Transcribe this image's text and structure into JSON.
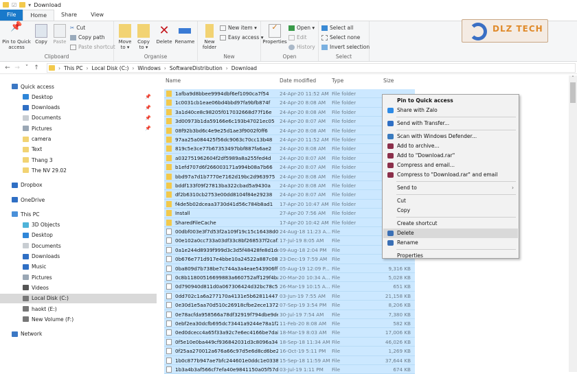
{
  "window": {
    "title": "Download"
  },
  "tabs": [
    {
      "label": "File"
    },
    {
      "label": "Home"
    },
    {
      "label": "Share"
    },
    {
      "label": "View"
    }
  ],
  "ribbon": {
    "clipboard": {
      "label": "Clipboard",
      "pin": "Pin to Quick access",
      "copy": "Copy",
      "paste": "Paste",
      "cut": "Cut",
      "copy_path": "Copy path",
      "paste_shortcut": "Paste shortcut"
    },
    "organise": {
      "label": "Organise",
      "move_to": "Move to ▾",
      "copy_to": "Copy to ▾",
      "delete": "Delete",
      "rename": "Rename"
    },
    "new": {
      "label": "New",
      "new_folder": "New folder",
      "new_item": "New item ▾",
      "easy_access": "Easy access ▾"
    },
    "open": {
      "label": "Open",
      "properties": "Properties",
      "open": "Open ▾",
      "edit": "Edit",
      "history": "History"
    },
    "select": {
      "label": "Select",
      "select_all": "Select all",
      "select_none": "Select none",
      "invert": "Invert selection"
    }
  },
  "logo": {
    "text": "DLZ TECH"
  },
  "address": {
    "crumbs": [
      "This PC",
      "Local Disk (C:)",
      "Windows",
      "SoftwareDistribution",
      "Download"
    ]
  },
  "sidebar": [
    {
      "label": "Quick access",
      "level": 0,
      "icon": "star",
      "color": "#3b78c4"
    },
    {
      "label": "Desktop",
      "level": 1,
      "icon": "desktop",
      "color": "#2f86d8",
      "pinned": true
    },
    {
      "label": "Downloads",
      "level": 1,
      "icon": "download",
      "color": "#2f6fc4",
      "pinned": true
    },
    {
      "label": "Documents",
      "level": 1,
      "icon": "document",
      "color": "#c8cdd2",
      "pinned": true
    },
    {
      "label": "Pictures",
      "level": 1,
      "icon": "pictures",
      "color": "#9aa7b5",
      "pinned": true
    },
    {
      "label": "camera",
      "level": 1,
      "icon": "folder",
      "color": "#f2d373"
    },
    {
      "label": "Text",
      "level": 1,
      "icon": "folder",
      "color": "#f2d373"
    },
    {
      "label": "Thang 3",
      "level": 1,
      "icon": "folder",
      "color": "#f2d373"
    },
    {
      "label": "The NV 29.02",
      "level": 1,
      "icon": "folder",
      "color": "#f2d373"
    },
    {
      "label": "Dropbox",
      "level": 0,
      "icon": "dropbox",
      "color": "#2f6fc4",
      "gap": true
    },
    {
      "label": "OneDrive",
      "level": 0,
      "icon": "cloud",
      "color": "#2f6fc4",
      "gap": true
    },
    {
      "label": "This PC",
      "level": 0,
      "icon": "computer",
      "color": "#4a90d9",
      "gap": true
    },
    {
      "label": "3D Objects",
      "level": 1,
      "icon": "cube",
      "color": "#4fb3d9"
    },
    {
      "label": "Desktop",
      "level": 1,
      "icon": "desktop",
      "color": "#2f86d8"
    },
    {
      "label": "Documents",
      "level": 1,
      "icon": "document",
      "color": "#c8cdd2"
    },
    {
      "label": "Downloads",
      "level": 1,
      "icon": "download",
      "color": "#2f6fc4"
    },
    {
      "label": "Music",
      "level": 1,
      "icon": "music",
      "color": "#2f6fc4"
    },
    {
      "label": "Pictures",
      "level": 1,
      "icon": "pictures",
      "color": "#9aa7b5"
    },
    {
      "label": "Videos",
      "level": 1,
      "icon": "video",
      "color": "#555"
    },
    {
      "label": "Local Disk (C:)",
      "level": 1,
      "icon": "drive",
      "color": "#777",
      "selected": true
    },
    {
      "label": "haokt (E:)",
      "level": 1,
      "icon": "drive",
      "color": "#777"
    },
    {
      "label": "New Volume (F:)",
      "level": 1,
      "icon": "drive",
      "color": "#777"
    },
    {
      "label": "Network",
      "level": 0,
      "icon": "network",
      "color": "#3b78c4",
      "gap": true
    }
  ],
  "columns": {
    "name": "Name",
    "date": "Date modified",
    "type": "Type",
    "size": "Size"
  },
  "files": [
    {
      "name": "1afba9d8bbee9994dbf6ef1090ca7f54",
      "date": "24-Apr-20 11:52 AM",
      "type": "File folder",
      "size": "",
      "folder": true
    },
    {
      "name": "1c0031cb1eae06bd4bbd97fa9bfb874f",
      "date": "24-Apr-20 8:08 AM",
      "type": "File folder",
      "size": "",
      "folder": true
    },
    {
      "name": "3a1d40ce8c98205f017032668d77f16e",
      "date": "24-Apr-20 8:08 AM",
      "type": "File folder",
      "size": "",
      "folder": true
    },
    {
      "name": "3d00973b1da59166e6c193b47021ec05",
      "date": "24-Apr-20 8:07 AM",
      "type": "File folder",
      "size": "",
      "folder": true
    },
    {
      "name": "08f92b3bd6c4e9e25d1ae3f9002f0ff6",
      "date": "24-Apr-20 8:08 AM",
      "type": "File folder",
      "size": "",
      "folder": true
    },
    {
      "name": "97aa25a084425f56dc9063c70cc13b48",
      "date": "24-Apr-20 11:52 AM",
      "type": "File folder",
      "size": "",
      "folder": true
    },
    {
      "name": "819c5e3ce77b67353497bbf887fa6ae2",
      "date": "24-Apr-20 8:08 AM",
      "type": "File folder",
      "size": "",
      "folder": true
    },
    {
      "name": "a032751962604f2df5989a8a255fed4d",
      "date": "24-Apr-20 8:07 AM",
      "type": "File folder",
      "size": "",
      "folder": true
    },
    {
      "name": "b1efd707d6f266003171a994b08a7b66",
      "date": "24-Apr-20 8:07 AM",
      "type": "File folder",
      "size": "",
      "folder": true
    },
    {
      "name": "bbd97a7d1b7770e7162d19bc2d963975",
      "date": "24-Apr-20 8:08 AM",
      "type": "File folder",
      "size": "",
      "folder": true
    },
    {
      "name": "bddf133f09f27813ba322cbad5a9430a",
      "date": "24-Apr-20 8:08 AM",
      "type": "File folder",
      "size": "",
      "folder": true
    },
    {
      "name": "df2b6310cb2753e00dd8104f84e29238",
      "date": "24-Apr-20 8:07 AM",
      "type": "File folder",
      "size": "",
      "folder": true
    },
    {
      "name": "f4de5b02dceaa3730d41d56c784b8ad1",
      "date": "17-Apr-20 10:47 AM",
      "type": "File folder",
      "size": "",
      "folder": true
    },
    {
      "name": "Install",
      "date": "27-Apr-20 7:56 AM",
      "type": "File folder",
      "size": "",
      "folder": true
    },
    {
      "name": "SharedFileCache",
      "date": "17-Apr-20 10:42 AM",
      "type": "File folder",
      "size": "",
      "folder": true
    },
    {
      "name": "00dbf003e3f7d53f2a109f19c15c16438d0c...",
      "date": "24-Aug-18 11:23 A...",
      "type": "File",
      "size": ""
    },
    {
      "name": "00e102a0cc733a03df33c8bf268537f2caf3a...",
      "date": "17-Jul-19 8:05 AM",
      "type": "File",
      "size": ""
    },
    {
      "name": "0a1e244d8939f999d3c3d5f48428fe8d1dc3...",
      "date": "09-Aug-18 2:04 PM",
      "type": "File",
      "size": ""
    },
    {
      "name": "0b676e771d917e4bbe10a24522a887c081d...",
      "date": "23-Dec-19 7:59 AM",
      "type": "File",
      "size": ""
    },
    {
      "name": "0ba809d7b738be7c744a3a4eae543906ffbf...",
      "date": "05-Aug-19 12:09 P...",
      "type": "File",
      "size": "9,316 KB"
    },
    {
      "name": "0c8b11800516699883a660752aff129f4baf8...",
      "date": "20-Mar-20 10:34 A...",
      "type": "File",
      "size": "5,028 KB"
    },
    {
      "name": "0d790940d811d0a067306424d32bc78c5b7...",
      "date": "26-Mar-19 10:15 A...",
      "type": "File",
      "size": "651 KB"
    },
    {
      "name": "0dd702c1a6a277170a4131e5b6281144774...",
      "date": "03-Jun-19 7:55 AM",
      "type": "File",
      "size": "21,158 KB"
    },
    {
      "name": "0e30d1e5aa70d510c26918cfbe2ece1372f3...",
      "date": "07-Sep-19 3:54 PM",
      "type": "File",
      "size": "8,206 KB"
    },
    {
      "name": "0e78acfda958566a78df32919f794dbe9de6...",
      "date": "30-Jul-19 7:54 AM",
      "type": "File",
      "size": "7,380 KB"
    },
    {
      "name": "0ebf2ea30dcfb695dc73441a9244e78a1f27...",
      "date": "11-Feb-20 8:08 AM",
      "type": "File",
      "size": "582 KB"
    },
    {
      "name": "0ed0dcecc4a65f33a92c7e6ec4166be7dab...",
      "date": "18-Mar-19 8:03 AM",
      "type": "File",
      "size": "17,006 KB"
    },
    {
      "name": "0f5e10e0ba449cf936842031d3c8096a340f...",
      "date": "18-Sep-18 11:34 AM",
      "type": "File",
      "size": "46,026 KB"
    },
    {
      "name": "0f25aa270012a676a66c97d5e6d8cd6be21...",
      "date": "16-Oct-19 5:11 PM",
      "type": "File",
      "size": "1,269 KB"
    },
    {
      "name": "1b0c877b947ae7bfc244601e0ddc1e03383...",
      "date": "15-Sep-18 11:59 AM",
      "type": "File",
      "size": "37,644 KB"
    },
    {
      "name": "1b3a4b3af566cf7efa40e9841150a05f57d36...",
      "date": "03-Jul-19 1:11 PM",
      "type": "File",
      "size": "674 KB"
    }
  ],
  "context_menu": [
    {
      "label": "Pin to Quick access",
      "bold": true
    },
    {
      "label": "Share with Zalo",
      "icon": "zalo",
      "color": "#2e8be6"
    },
    {
      "sep": true
    },
    {
      "label": "Send with Transfer...",
      "icon": "dropbox",
      "color": "#2f6fc4"
    },
    {
      "sep": true
    },
    {
      "label": "Scan with Windows Defender...",
      "icon": "defender",
      "color": "#3a7bbf"
    },
    {
      "label": "Add to archive...",
      "icon": "winrar",
      "color": "#8b2f4a"
    },
    {
      "label": "Add to \"Download.rar\"",
      "icon": "winrar",
      "color": "#8b2f4a"
    },
    {
      "label": "Compress and email...",
      "icon": "winrar",
      "color": "#8b2f4a"
    },
    {
      "label": "Compress to \"Download.rar\" and email",
      "icon": "winrar",
      "color": "#8b2f4a"
    },
    {
      "sep": true
    },
    {
      "label": "Send to",
      "submenu": true
    },
    {
      "sep": true
    },
    {
      "label": "Cut"
    },
    {
      "label": "Copy"
    },
    {
      "sep": true
    },
    {
      "label": "Create shortcut"
    },
    {
      "label": "Delete",
      "icon": "shield",
      "color": "#3a6fb5",
      "highlighted": true
    },
    {
      "label": "Rename",
      "icon": "shield",
      "color": "#3a6fb5"
    },
    {
      "sep": true
    },
    {
      "label": "Properties"
    }
  ],
  "colors": {
    "accent": "#1979ca",
    "selection": "#cce8ff",
    "folder": "#f2c94c"
  }
}
